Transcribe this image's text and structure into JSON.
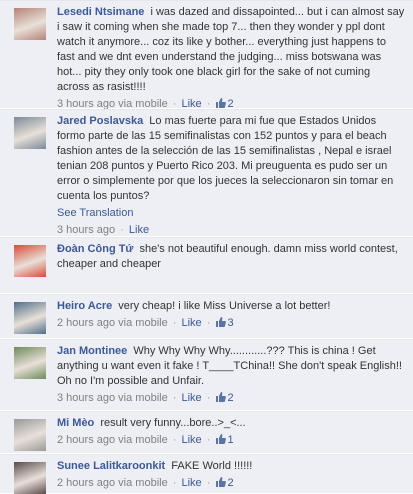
{
  "comments": [
    {
      "author": "Lesedi Ntsimane",
      "text": "i was dazed and dissapointed... but i can almost say i saw it coming when she made top 7... then they wonder y ppl dont watch it anymore... coz its like y bother... everything just happens to fast and we dnt even understand the judging... miss botswana was hot... pity they only took one black girl for the sake of not cuming across as rasist!!!!",
      "time": "3 hours ago",
      "via": "via mobile",
      "like_label": "Like",
      "like_count": "2",
      "avatar_color": "#b5837a"
    },
    {
      "author": "Jared Poslavska",
      "text": "Lo mas fuerte para mi fue que Estados Unidos formo parte de las 15 semifinalistas con 152 puntos y para el beach fashion antes de la selección de las 15 semifinalistas , Nepal e israel tenian 208 puntos y Puerto Rico 203. Mi preuguenta es pudo ser un error o simplemente por que los jueces la seleccionaron sin tomar en cuenta los puntos?",
      "see_translation": "See Translation",
      "time": "3 hours ago",
      "via": "",
      "like_label": "Like",
      "like_count": "",
      "avatar_color": "#7a8a9a"
    },
    {
      "author": "Đoàn Công Tứ",
      "text": "she's not beautiful enough. damn miss world contest, cheaper and cheaper",
      "time": "3 hours ago",
      "via": "",
      "like_label": "Like",
      "like_count": "",
      "avatar_color": "#d94a3a"
    },
    {
      "author": "Heiro Acre",
      "text": "very cheap! i like Miss Universe a lot better!",
      "time": "2 hours ago",
      "via": "via mobile",
      "like_label": "Like",
      "like_count": "3",
      "avatar_color": "#4f6f8a"
    },
    {
      "author": "Jan Montinee",
      "text": "Why Why Why Why............??? This is china ! Get anything u want even it fake ! T____TChina!! She don't speak English!! Oh no I'm possible and Unfair.",
      "time": "3 hours ago",
      "via": "via mobile",
      "like_label": "Like",
      "like_count": "2",
      "avatar_color": "#6f8a5a"
    },
    {
      "author": "Mi Mèo",
      "text": "result very funny...bore..>_<...",
      "time": "2 hours ago",
      "via": "via mobile",
      "like_label": "Like",
      "like_count": "1",
      "avatar_color": "#9a9a9a"
    },
    {
      "author": "Sunee Lalitkaroonkit",
      "text": "FAKE World !!!!!!",
      "time": "2 hours ago",
      "via": "via mobile",
      "like_label": "Like",
      "like_count": "2",
      "avatar_color": "#5a4a4a"
    }
  ]
}
